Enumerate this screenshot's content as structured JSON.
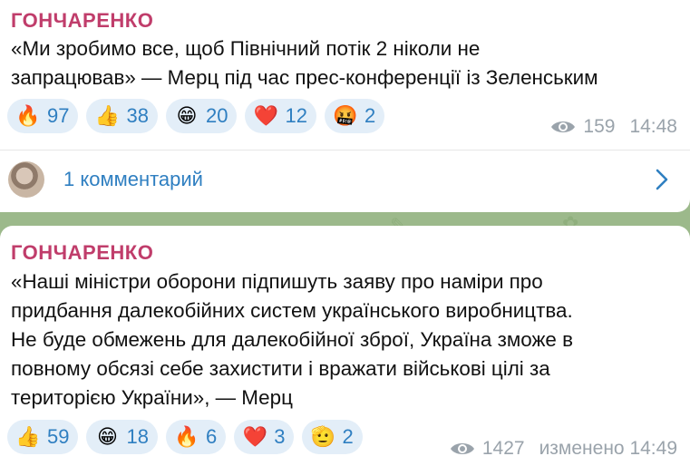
{
  "messages": [
    {
      "author": "ГОНЧАРЕНКО",
      "lines": [
        "«Ми зробимо все, щоб Північний потік 2 ніколи не",
        "запрацював» — Мерц під час прес-конференції із Зеленським"
      ],
      "reactions": [
        {
          "emoji": "🔥",
          "icon": "fire-icon",
          "count": "97"
        },
        {
          "emoji": "👍",
          "icon": "thumbs-up-icon",
          "count": "38"
        },
        {
          "emoji": "😁",
          "icon": "grinning-face-icon",
          "count": "20"
        },
        {
          "emoji": "❤️",
          "icon": "red-heart-icon",
          "count": "12"
        },
        {
          "emoji": "🤬",
          "icon": "cursing-face-icon",
          "count": "2"
        }
      ],
      "views": "159",
      "time": "14:48",
      "comments_label": "1 комментарий"
    },
    {
      "author": "ГОНЧАРЕНКО",
      "lines": [
        "«Наші міністри оборони підпишуть заяву про наміри про",
        "придбання далекобійних систем українського виробництва.",
        "Не буде обмежень для далекобійної зброї, Україна зможе в",
        "повному обсязі себе захистити і вражати військові цілі за",
        "територією України», — Мерц"
      ],
      "reactions": [
        {
          "emoji": "👍",
          "icon": "thumbs-up-icon",
          "count": "59"
        },
        {
          "emoji": "😁",
          "icon": "grinning-face-icon",
          "count": "18"
        },
        {
          "emoji": "🔥",
          "icon": "fire-icon",
          "count": "6"
        },
        {
          "emoji": "❤️",
          "icon": "red-heart-icon",
          "count": "3"
        },
        {
          "emoji": "🫡",
          "icon": "saluting-face-icon",
          "count": "2"
        }
      ],
      "views": "1427",
      "time": "изменено 14:49"
    }
  ],
  "colors": {
    "background": "#9cb98b",
    "author": "#c03d6b",
    "accent": "#2f7fc1",
    "reaction_bg": "#e3eef8",
    "meta": "#9aa3ab"
  }
}
